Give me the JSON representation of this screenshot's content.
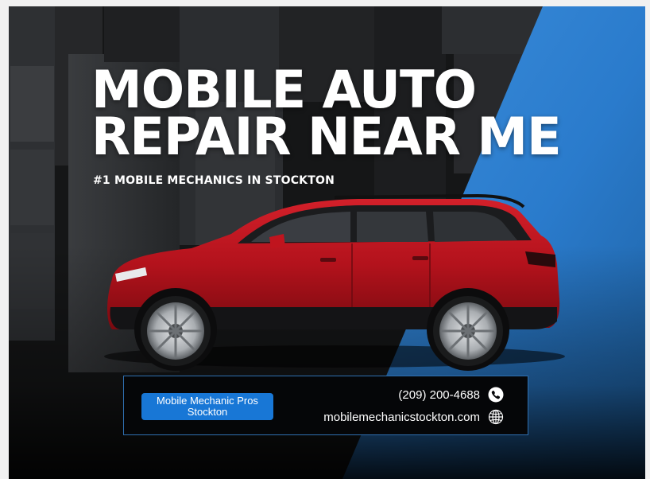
{
  "headline": {
    "line1": "MOBILE AUTO",
    "line2": "REPAIR NEAR ME"
  },
  "subtitle": "#1 MOBILE MECHANICS IN STOCKTON",
  "contact": {
    "brand_line1": "Mobile Mechanic Pros",
    "brand_line2": "Stockton",
    "phone": "(209) 200-4688",
    "website": "mobilemechanicstockton.com"
  },
  "icons": {
    "phone": "phone-icon",
    "website": "globe-icon"
  },
  "colors": {
    "accent_blue": "#1877d6",
    "panel_blue": "#2c7fd0",
    "car_red": "#b3121c",
    "background_dark": "#0b0b0b"
  }
}
